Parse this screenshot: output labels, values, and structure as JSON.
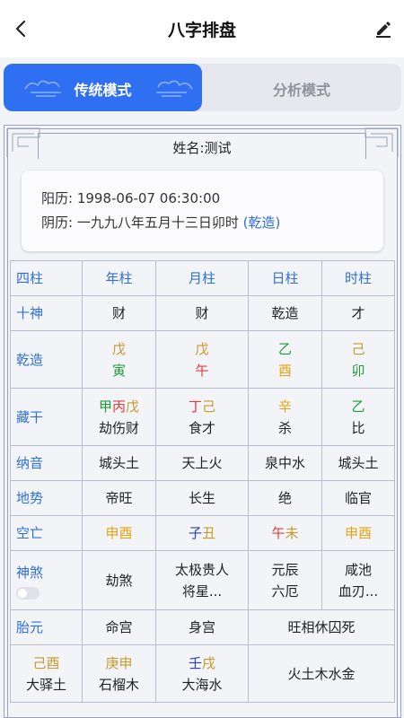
{
  "header": {
    "title": "八字排盘",
    "back_icon": "chevron-left-icon",
    "edit_icon": "pen-icon"
  },
  "tabs": [
    {
      "label": "传统模式",
      "active": true
    },
    {
      "label": "分析模式",
      "active": false
    }
  ],
  "colors": {
    "accent": "#2f6ff2",
    "label_blue": "#2f6fd8",
    "green": "#1d9b3a",
    "red": "#e43b3b",
    "orange": "#e8a312",
    "gold": "#c59a2e",
    "deep_blue": "#2340c8",
    "purple": "#7b3bb3"
  },
  "profile": {
    "name": "姓名:测试",
    "solar_label": "阳历:",
    "solar_value": "1998-06-07 06:30:00",
    "lunar_label": "阴历:",
    "lunar_value": "一九九八年五月十三日卯时",
    "lunar_tag": "(乾造)"
  },
  "table": {
    "headers": [
      "四柱",
      "年柱",
      "月柱",
      "日柱",
      "时柱"
    ],
    "shishen": {
      "label": "十神",
      "values": [
        "财",
        "财",
        "乾造",
        "才"
      ]
    },
    "qianzao": {
      "label": "乾造",
      "stems": [
        "戊",
        "戊",
        "乙",
        "己"
      ],
      "branches": [
        "寅",
        "午",
        "酉",
        "卯"
      ]
    },
    "canggan": {
      "label": "藏干",
      "year_stems": [
        "甲",
        "丙",
        "戊"
      ],
      "month_stems": [
        "丁",
        "己"
      ],
      "day_stems": [
        "辛"
      ],
      "hour_stems": [
        "乙"
      ],
      "gods": [
        "劫伤财",
        "食才",
        "杀",
        "比"
      ]
    },
    "nayin": {
      "label": "纳音",
      "values": [
        "城头土",
        "天上火",
        "泉中水",
        "城头土"
      ]
    },
    "dishi": {
      "label": "地势",
      "values": [
        "帝旺",
        "长生",
        "绝",
        "临官"
      ]
    },
    "kongwang": {
      "label": "空亡",
      "year": [
        "申",
        "酉"
      ],
      "month": [
        "子",
        "丑"
      ],
      "day": [
        "午",
        "未"
      ],
      "hour": [
        "申",
        "酉"
      ]
    },
    "shensha": {
      "label": "神煞",
      "toggle_on": false,
      "year": [
        "劫煞"
      ],
      "month": [
        "太极贵人",
        "将星..."
      ],
      "day": [
        "元辰",
        "六厄"
      ],
      "hour": [
        "咸池",
        "血刃..."
      ]
    },
    "taiyuan": {
      "label": "胎元",
      "minggong": "命宫",
      "shengong": "身宫",
      "wangxiang": "旺相休囚死"
    },
    "bottom": {
      "c1": {
        "stems": [
          "己",
          "酉"
        ],
        "nayin": "大驿土"
      },
      "c2": {
        "stems": [
          "庚",
          "申"
        ],
        "nayin": "石榴木"
      },
      "c3": {
        "stems": [
          "壬",
          "戌"
        ],
        "nayin": "大海水"
      },
      "wuxing": "火土木水金"
    }
  }
}
